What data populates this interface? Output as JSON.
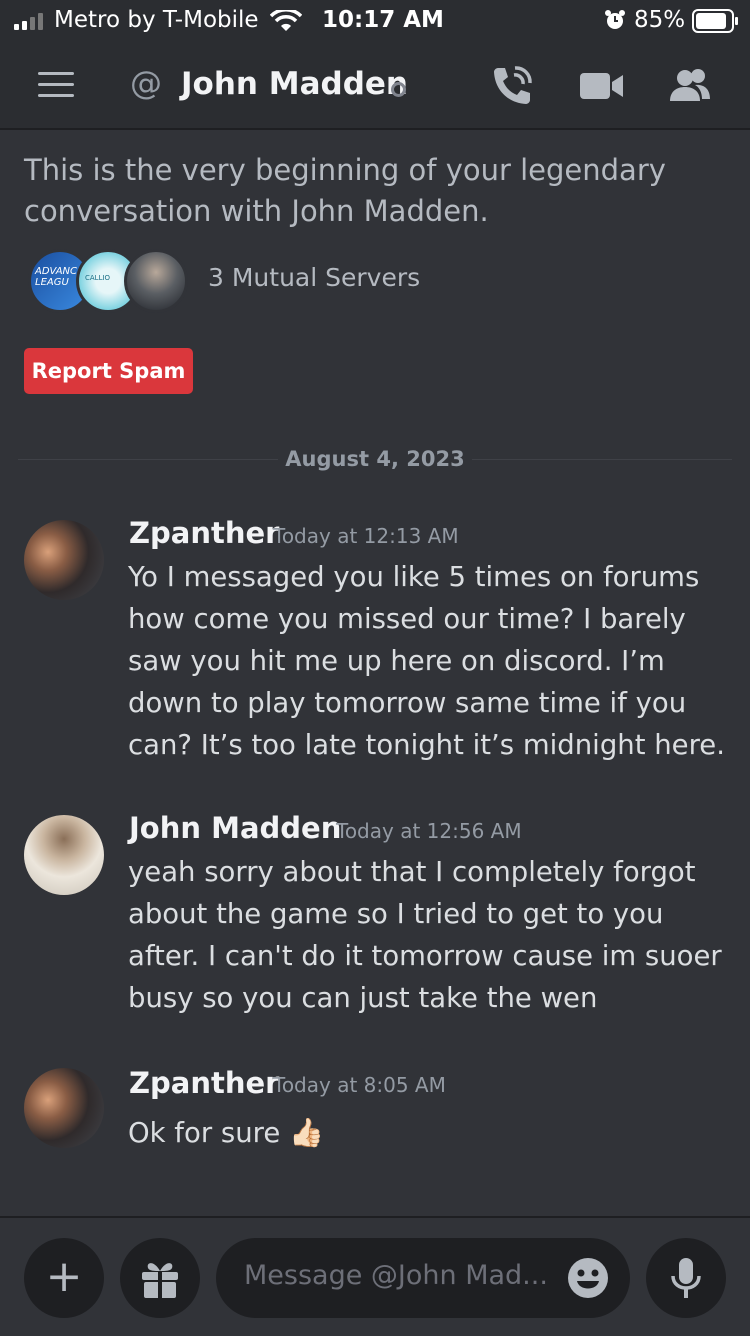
{
  "status_bar": {
    "carrier": "Metro by T-Mobile",
    "time": "10:17 AM",
    "battery_percent": "85%"
  },
  "header": {
    "at_symbol": "@",
    "title": "John Madden",
    "icons": [
      "hamburger-menu-icon",
      "at-icon",
      "phone-call-icon",
      "video-camera-icon",
      "members-icon"
    ]
  },
  "intro": {
    "text": "This is the very beginning of your legendary conversation with John Madden.",
    "mutual_servers_label": "3 Mutual Servers",
    "server_icons": [
      {
        "label": "ADVANC LEAGU"
      },
      {
        "label": "CALLIO"
      },
      {
        "label": ""
      }
    ],
    "report_spam_label": "Report Spam"
  },
  "date_divider": "August 4, 2023",
  "messages": [
    {
      "author": "Zpanther",
      "time": "Today at 12:13 AM",
      "body": "Yo I messaged you like 5 times on forums how come you missed our time? I barely saw you hit me up here on discord. I’m down to play tomorrow same time if you can? It’s too late tonight it’s midnight here."
    },
    {
      "author": "John Madden",
      "time": "Today at 12:56 AM",
      "body": "yeah sorry about that I completely forgot about the game so I tried to get to you after. I can't do it tomorrow cause im suoer busy so you can just take the wen"
    },
    {
      "author": "Zpanther",
      "time": "Today at 8:05 AM",
      "body": "Ok for sure",
      "emoji": "👍🏻"
    }
  ],
  "composer": {
    "placeholder": "Message @John Mad...",
    "plus_symbol": "+"
  },
  "colors": {
    "background": "#313338",
    "header": "#2b2d31",
    "input": "#1e1f22",
    "danger": "#da373c"
  }
}
